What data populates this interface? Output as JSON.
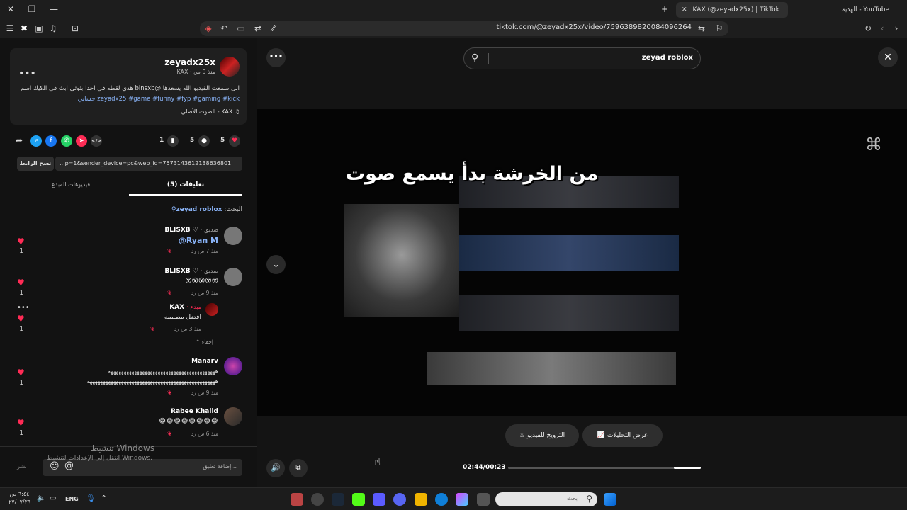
{
  "titlebar": {
    "active_tab": "KAX (@zeyadx25x) | TikTok",
    "other_tab": "الهدية - YouTube",
    "new_tab": "+"
  },
  "addressbar": {
    "url": "tiktok.com/@zeyadx25x/video/7596389820084096264"
  },
  "post": {
    "username": "zeyadx25x",
    "display_meta": "KAX · منذ 9 س",
    "caption_line1": "الى سمعت الفيديو الله يسعدها @blnsxb هذي لقطه في احدا بثوثي ابث في الكيك اسم",
    "caption_line2": "حسابي zeyadx25 #game #funny #fyp #gaming #kick",
    "sound": "الصوت الأصلي - KAX",
    "likes": "5",
    "comments": "5",
    "saves": "1",
    "link": "...p=1&sender_device=pc&web_id=7573143612138636801",
    "copy_link": "نسخ الرابط"
  },
  "tabs": {
    "comments": "(5) تعليقات",
    "creator_videos": "فيديوهات المبدع"
  },
  "search_hint": {
    "label": "البحث:",
    "term": "zeyad roblox"
  },
  "comments": [
    {
      "name": "BLISXB",
      "tag": "· صديق",
      "text": "@Ryan M",
      "meta": "منذ 7 س    رد",
      "likes": "1"
    },
    {
      "name": "BLISXB",
      "tag": "· صديق",
      "text": "😵😵😵😵😵",
      "meta": "منذ 9 س    رد",
      "likes": "1"
    },
    {
      "name": "KAX",
      "tag": "· مبدع",
      "text": "افضل مصممه",
      "meta": "منذ 3 س    رد",
      "likes": "1"
    },
    {
      "name": "Manarv",
      "tag": "",
      "text": "هههههههههههههههههههههههههههههههههههههههههه",
      "text2": "هههههههههههههههههههههههههههههههههههههههههههههههههه",
      "meta": "منذ 9 س    رد",
      "likes": "1"
    },
    {
      "name": "Rabee Khalid",
      "tag": "",
      "text": "😂😂😂😂😂😂😂😂",
      "meta": "منذ 6 س    رد",
      "likes": "1"
    }
  ],
  "hide_label": "إخفاء",
  "comment_box": {
    "placeholder": "إضافة تعليق...",
    "post": "نشر"
  },
  "activation": {
    "title": "تنشيط Windows",
    "subtitle": "انتقل إلى الإعدادات لتنشيط Windows."
  },
  "player": {
    "search_text": "zeyad roblox",
    "overlay_caption": "من الخرشة بدأ يسمع صوت",
    "promote_btn": "الترويج للفيديو",
    "analytics_btn": "عرض التحليلات",
    "time": "02:44/00:23",
    "progress": 0.14
  },
  "taskbar": {
    "search_placeholder": "بحث",
    "lang": "ENG",
    "time": "٦:٤٤ ص",
    "date": "٢٧/٠٧/٢٩"
  },
  "colors": {
    "accent_red": "#fe2c55",
    "link_blue": "#8ab4f8"
  }
}
